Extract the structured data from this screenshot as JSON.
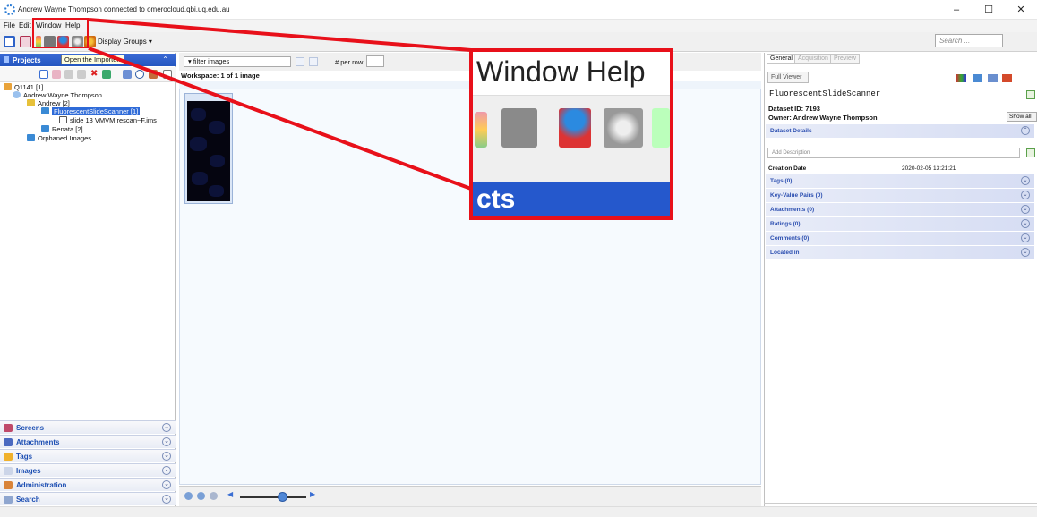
{
  "titlebar": {
    "title": "Andrew Wayne Thompson connected to omerocloud.qbi.uq.edu.au",
    "minimize": "–",
    "maximize": "☐",
    "close": "✕"
  },
  "menubar": {
    "items": [
      "File",
      "Edit",
      "Window",
      "Help"
    ]
  },
  "toolbar": {
    "display_groups": "Display Groups ▾",
    "search_placeholder": "Search ..."
  },
  "tooltip": "Open the Importer.",
  "left": {
    "header": "Projects",
    "tree": {
      "root": "Q1141 [1]",
      "user": "Andrew Wayne Thompson",
      "project": "Andrew [2]",
      "dataset": "FluorescentSlideScanner [1]",
      "image": "slide 13 VMVM rescan~F.ims",
      "project2": "Renata [2]",
      "orphaned": "Orphaned Images"
    },
    "accordion": [
      "Screens",
      "Attachments",
      "Tags",
      "Images",
      "Administration",
      "Search"
    ]
  },
  "center": {
    "filter": "▾ filter images",
    "per_row_label": "# per row:",
    "workspace_label": "Workspace: 1 of 1 image"
  },
  "right": {
    "tabs": [
      "General",
      "Acquisition",
      "Preview"
    ],
    "full_viewer": "Full Viewer",
    "name": "FluorescentSlideScanner",
    "dataset_id": "Dataset ID: 7193",
    "owner": "Owner: Andrew Wayne Thompson",
    "show_all": "Show all",
    "dataset_details": "Dataset Details",
    "add_description": "Add Description",
    "creation_label": "Creation Date",
    "creation_value": "2020-02-05 13:21:21",
    "sections": [
      "Tags (0)",
      "Key-Value Pairs (0)",
      "Attachments (0)",
      "Ratings (0)",
      "Comments (0)",
      "Located in"
    ]
  },
  "zoom": {
    "menu": "Window   Help",
    "footer": "cts"
  }
}
